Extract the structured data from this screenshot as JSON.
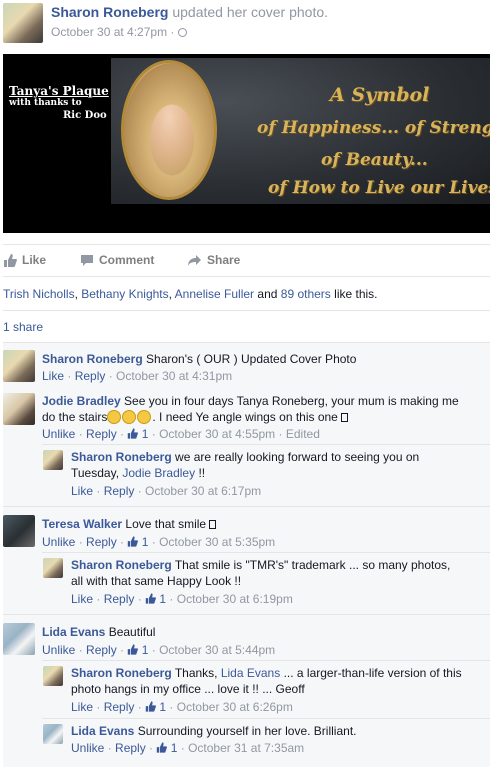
{
  "post": {
    "author": "Sharon Roneberg",
    "action": "updated her cover photo.",
    "time": "October 30 at 4:27pm"
  },
  "cover": {
    "plaque_title": "Tanya's Plaque",
    "plaque_sub": "with thanks to",
    "plaque_who": "Ric Doo",
    "quote_lines": [
      "A Symbol",
      "of Happiness... of Strength...",
      "of Beauty...",
      "of How to Live our Lives"
    ]
  },
  "actions": {
    "like": "Like",
    "comment": "Comment",
    "share": "Share"
  },
  "likes": {
    "name1": "Trish Nicholls",
    "name2": "Bethany Knights",
    "name3": "Annelise Fuller",
    "and": "and",
    "others": "89 others",
    "suffix": "like this."
  },
  "shares": "1 share",
  "comments": [
    {
      "name": "Sharon Roneberg",
      "text": "Sharon's ( OUR ) Updated Cover Photo",
      "action1": "Like",
      "action2": "Reply",
      "time": "October 30 at 4:31pm"
    },
    {
      "name": "Jodie Bradley",
      "text1": "See you in four days Tanya Roneberg, your mum is making me",
      "text2a": "do the stairs",
      "text2b": ". I need Ye angle wings on this one",
      "action1": "Unlike",
      "action2": "Reply",
      "likes": "1",
      "time": "October 30 at 4:55pm",
      "edited": "Edited"
    },
    {
      "name": "Sharon Roneberg",
      "text1": "we are really looking forward to seeing you on",
      "text2a": "Tuesday,",
      "mention": "Jodie Bradley",
      "text2b": "!!",
      "action1": "Like",
      "action2": "Reply",
      "time": "October 30 at 6:17pm"
    },
    {
      "name": "Teresa Walker",
      "text": "Love that smile",
      "action1": "Unlike",
      "action2": "Reply",
      "likes": "1",
      "time": "October 30 at 5:35pm"
    },
    {
      "name": "Sharon Roneberg",
      "text1": "That smile is \"TMR's\" trademark ... so many photos,",
      "text2": "all with that same Happy Look !!",
      "action1": "Like",
      "action2": "Reply",
      "likes": "1",
      "time": "October 30 at 6:19pm"
    },
    {
      "name": "Lida Evans",
      "text": "Beautiful",
      "action1": "Unlike",
      "action2": "Reply",
      "likes": "1",
      "time": "October 30 at 5:44pm"
    },
    {
      "name": "Sharon Roneberg",
      "text1a": "Thanks,",
      "mention": "Lida Evans",
      "text1b": "... a larger-than-life version of this",
      "text2": "photo hangs in my office ... love it !! ... Geoff",
      "action1": "Like",
      "action2": "Reply",
      "likes": "1",
      "time": "October 30 at 6:26pm"
    },
    {
      "name": "Lida Evans",
      "text": "Surrounding yourself in her love. Brilliant.",
      "action1": "Unlike",
      "action2": "Reply",
      "likes": "1",
      "time": "October 31 at 7:35am"
    }
  ],
  "colors": {
    "link": "#3b5998",
    "meta": "#9197a3",
    "gold": "#d7b45c"
  }
}
